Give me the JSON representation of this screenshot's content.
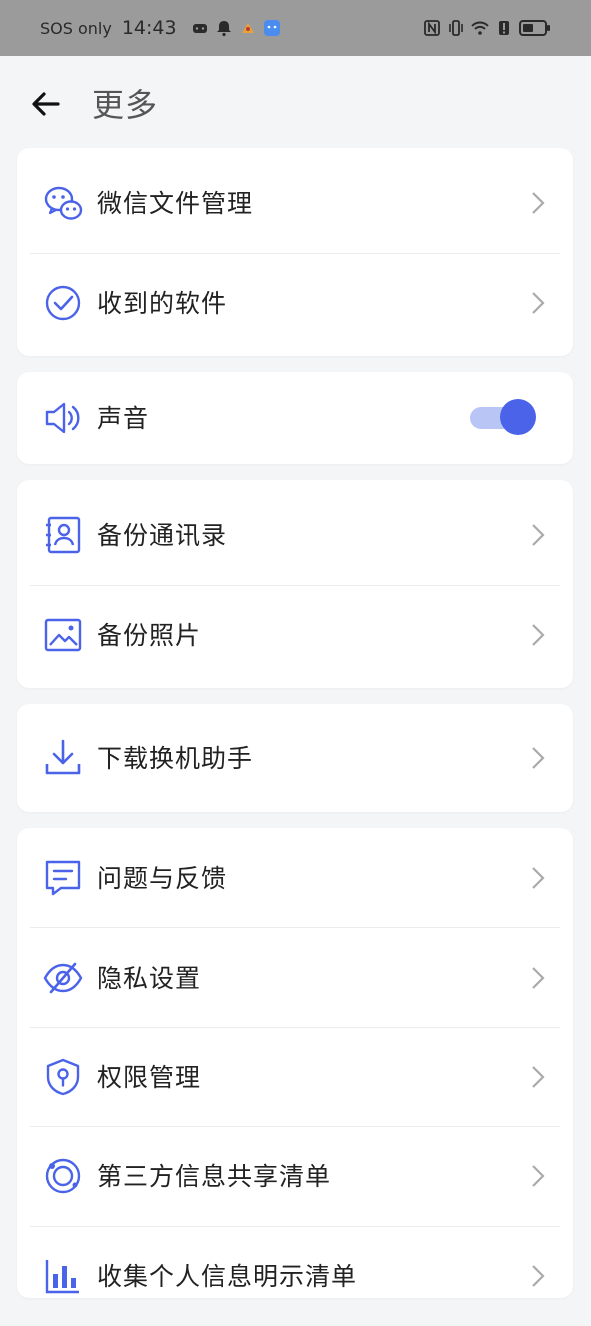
{
  "status_bar": {
    "carrier": "SOS only",
    "time": "14:43",
    "battery_icon": "battery-icon"
  },
  "header": {
    "back_icon": "arrow-left-icon",
    "title": "更多"
  },
  "colors": {
    "accent": "#4b63e8",
    "toggle_track": "#b9c6f5",
    "icon_blue": "#4b63e8",
    "status_bar_bg": "#9b9b9b"
  },
  "groups": [
    {
      "items": [
        {
          "icon": "wechat-icon",
          "label": "微信文件管理"
        },
        {
          "icon": "check-circle-icon",
          "label": "收到的软件"
        }
      ]
    },
    {
      "items": [
        {
          "icon": "speaker-icon",
          "label": "声音",
          "toggle": true,
          "toggle_on": true
        }
      ]
    },
    {
      "items": [
        {
          "icon": "contacts-icon",
          "label": "备份通讯录"
        },
        {
          "icon": "image-icon",
          "label": "备份照片"
        }
      ]
    },
    {
      "items": [
        {
          "icon": "download-icon",
          "label": "下载换机助手"
        }
      ]
    },
    {
      "items": [
        {
          "icon": "feedback-icon",
          "label": "问题与反馈"
        },
        {
          "icon": "eye-slash-icon",
          "label": "隐私设置"
        },
        {
          "icon": "shield-key-icon",
          "label": "权限管理"
        },
        {
          "icon": "planet-icon",
          "label": "第三方信息共享清单"
        },
        {
          "icon": "bar-chart-icon",
          "label": "收集个人信息明示清单"
        }
      ]
    }
  ]
}
